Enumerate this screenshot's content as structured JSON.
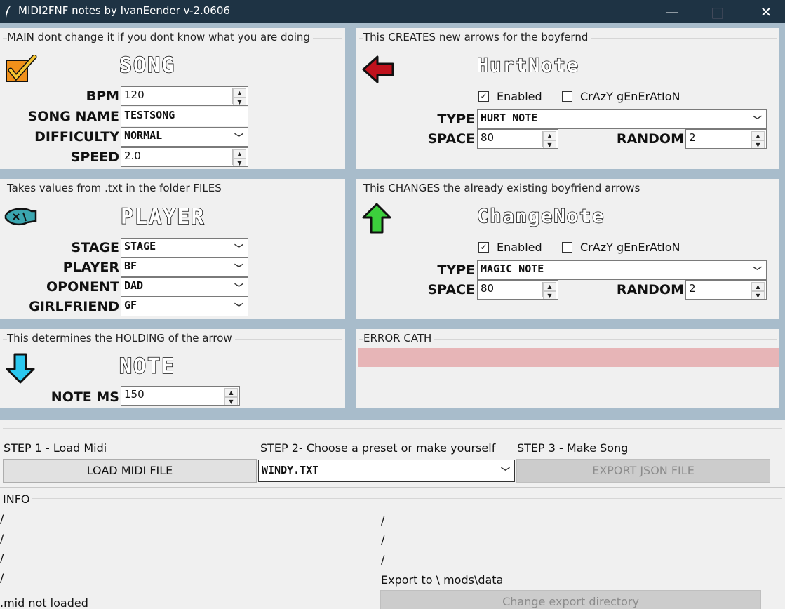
{
  "window": {
    "title": "MIDI2FNF notes by IvanEender v-2.0606",
    "minimize": "—",
    "maximize": "□",
    "close": "✕"
  },
  "song": {
    "frame_title": "MAIN dont change it if you dont know what you are doing",
    "heading": "SONG",
    "icon": "checkmark-note-icon",
    "bpm": {
      "label": "BPM",
      "value": "120"
    },
    "name": {
      "label": "SONG NAME",
      "value": "TESTSONG"
    },
    "difficulty": {
      "label": "DIFFICULTY",
      "value": "NORMAL"
    },
    "speed": {
      "label": "SPEED",
      "value": "2.0"
    }
  },
  "hurt": {
    "frame_title": "This CREATES new arrows for the boyfernd",
    "heading": "HurtNote",
    "icon": "left-arrow-icon",
    "enabled_label": "Enabled",
    "enabled_checked": true,
    "crazy_label": "CrAzY gEnErAtIoN",
    "crazy_checked": false,
    "type": {
      "label": "TYPE",
      "value": "HURT NOTE"
    },
    "space": {
      "label": "SPACE",
      "value": "80"
    },
    "random": {
      "label": "RANDOM",
      "value": "2"
    }
  },
  "player": {
    "frame_title": "Takes values from .txt in the folder FILES",
    "heading": "PLAYER",
    "icon": "player-icon",
    "stage": {
      "label": "STAGE",
      "value": "STAGE"
    },
    "player": {
      "label": "PLAYER",
      "value": "BF"
    },
    "oponent": {
      "label": "OPONENT",
      "value": "DAD"
    },
    "girlfriend": {
      "label": "GIRLFRIEND",
      "value": "GF"
    }
  },
  "change": {
    "frame_title": "This CHANGES the already existing boyfriend arrows",
    "heading": "ChangeNote",
    "icon": "up-arrow-icon",
    "enabled_label": "Enabled",
    "enabled_checked": true,
    "crazy_label": "CrAzY gEnErAtIoN",
    "crazy_checked": false,
    "type": {
      "label": "TYPE",
      "value": "MAGIC NOTE"
    },
    "space": {
      "label": "SPACE",
      "value": "80"
    },
    "random": {
      "label": "RANDOM",
      "value": "2"
    }
  },
  "note": {
    "frame_title": "This determines the HOLDING of the arrow",
    "heading": "NOTE",
    "icon": "down-arrow-icon",
    "ms": {
      "label": "NOTE MS",
      "value": "150"
    }
  },
  "error": {
    "frame_title": "ERROR CATH",
    "bar_color": "#e7b5b7"
  },
  "steps": {
    "step1": "STEP 1 - Load Midi",
    "step2": "STEP 2- Choose a preset or make yourself",
    "step3": "STEP 3 - Make Song",
    "load_button": "LOAD MIDI FILE",
    "preset": "WINDY.TXT",
    "export_button": "EXPORT JSON FILE"
  },
  "info": {
    "frame_title": "INFO",
    "left_lines": [
      "/",
      "/",
      "/",
      "/"
    ],
    "status": ".mid not loaded",
    "right_lines": [
      "/",
      "/",
      "/"
    ],
    "export_to": "Export to \\ mods\\data",
    "change_dir_button": "Change export directory"
  },
  "colors": {
    "titlebar": "#1e3344",
    "background": "#a8bccb",
    "panel": "#f0f0f0",
    "check_orange": "#f0901a",
    "hurt_red": "#c0121d",
    "up_green": "#3ccf3c",
    "down_cyan": "#2bc8f0",
    "player_teal": "#3aa6b0"
  }
}
